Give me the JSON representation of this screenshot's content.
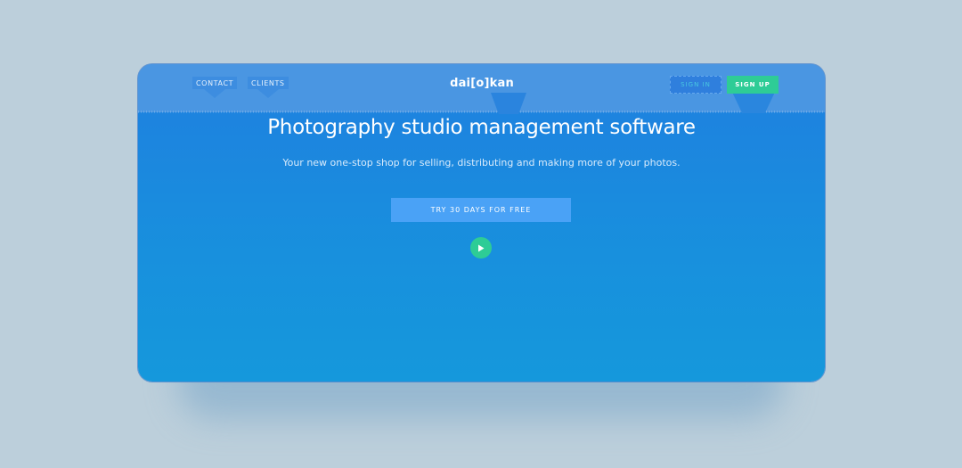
{
  "nav": {
    "items": [
      {
        "label": "CONTACT"
      },
      {
        "label": "CLIENTS"
      }
    ],
    "logo": "dai[o]kan",
    "signin_label": "SIGN IN",
    "signup_label": "SIGN UP"
  },
  "hero": {
    "title": "Photography studio management software",
    "subtitle": "Your new one-stop shop for selling, distributing and making more of your photos.",
    "cta_label": "TRY 30 DAYS FOR FREE",
    "play_icon": "play-icon"
  },
  "colors": {
    "background": "#bccfdb",
    "primary": "#1f7fe0",
    "accent_green": "#2ecc96",
    "cta": "#4aa2f6"
  }
}
